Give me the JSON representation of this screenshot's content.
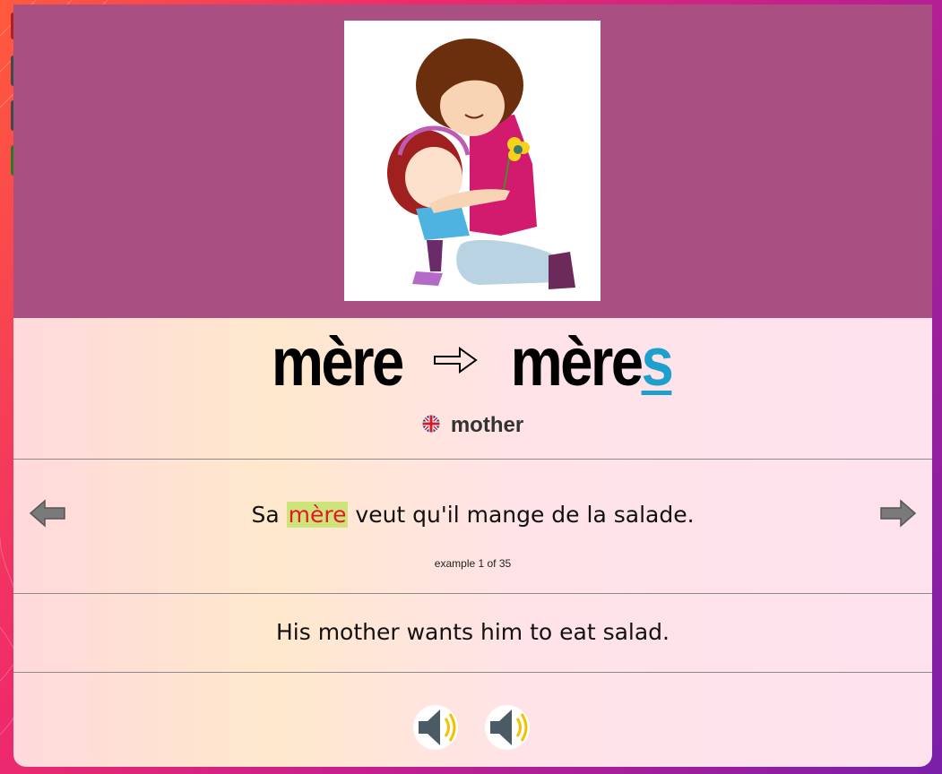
{
  "word": {
    "singular": "mère",
    "plural_stem": "mère",
    "plural_suffix": "s",
    "arrow_icon": "right-arrow-icon"
  },
  "translation": {
    "flag_icon": "uk-flag-icon",
    "text": "mother"
  },
  "example": {
    "before": "Sa ",
    "highlight": "mère",
    "after": " veut qu'il mange de la salade.",
    "counter": "example 1 of 35"
  },
  "english": {
    "sentence": "His mother wants him to eat salad."
  },
  "colors": {
    "image_panel": "#a94f82",
    "suffix": "#1ea0cc",
    "highlight_bg": "#cde47a",
    "highlight_text": "#e8142a",
    "speaker_wave": "#f2c200"
  },
  "icons": {
    "prev": "left-arrow-icon",
    "next": "right-arrow-icon",
    "audio": "speaker-icon"
  }
}
